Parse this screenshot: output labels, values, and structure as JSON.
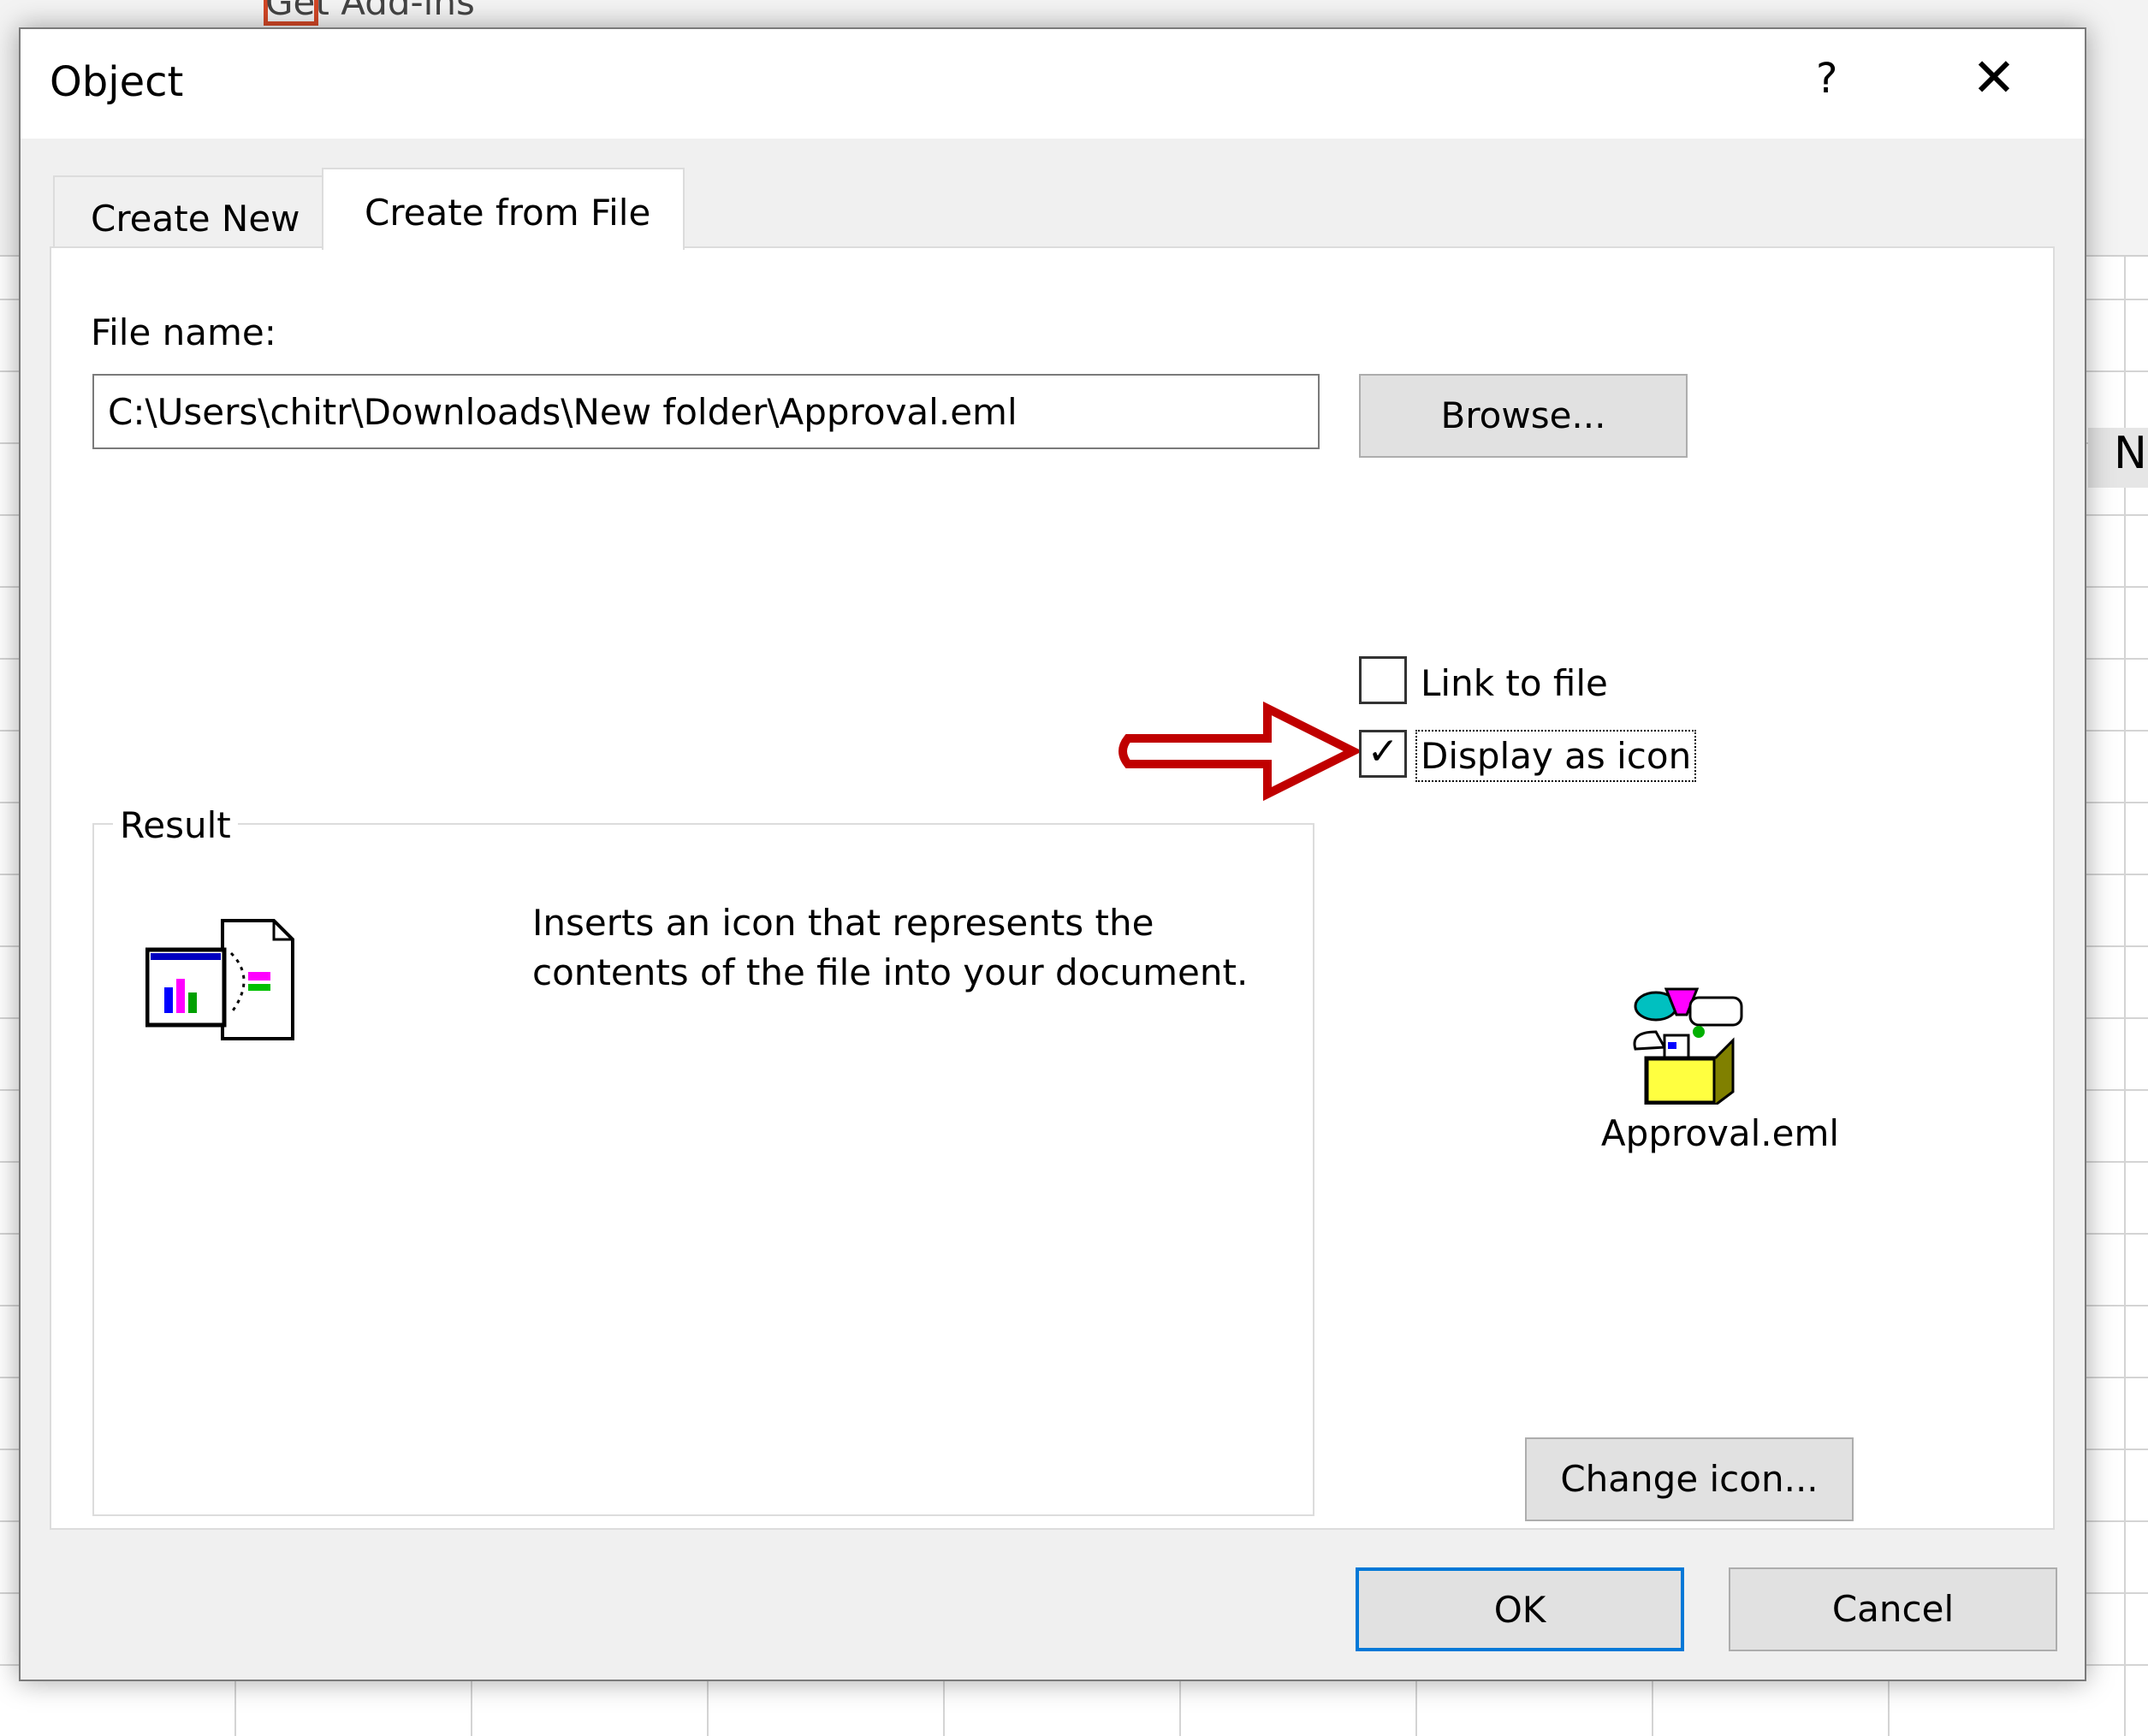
{
  "background": {
    "ribbon_item": "Get Add-ins",
    "column_header": "N"
  },
  "dialog": {
    "title": "Object",
    "help_label": "?",
    "close_label": "✕",
    "tabs": [
      {
        "label": "Create New",
        "active": false
      },
      {
        "label": "Create from File",
        "active": true
      }
    ],
    "file_name_label": "File name:",
    "file_name_value": "C:\\Users\\chitr\\Downloads\\New folder\\Approval.eml",
    "browse_label": "Browse...",
    "link_to_file": {
      "label": "Link to file",
      "checked": false
    },
    "display_as_icon": {
      "label": "Display as icon",
      "checked": true,
      "check_glyph": "✓"
    },
    "result": {
      "legend": "Result",
      "text": "Inserts an icon that represents the contents of the file into your document."
    },
    "icon_caption": "Approval.eml",
    "change_icon_label": "Change icon...",
    "ok_label": "OK",
    "cancel_label": "Cancel",
    "annotation_arrow_color": "#c00000",
    "ok_border_color": "#0078d7"
  }
}
